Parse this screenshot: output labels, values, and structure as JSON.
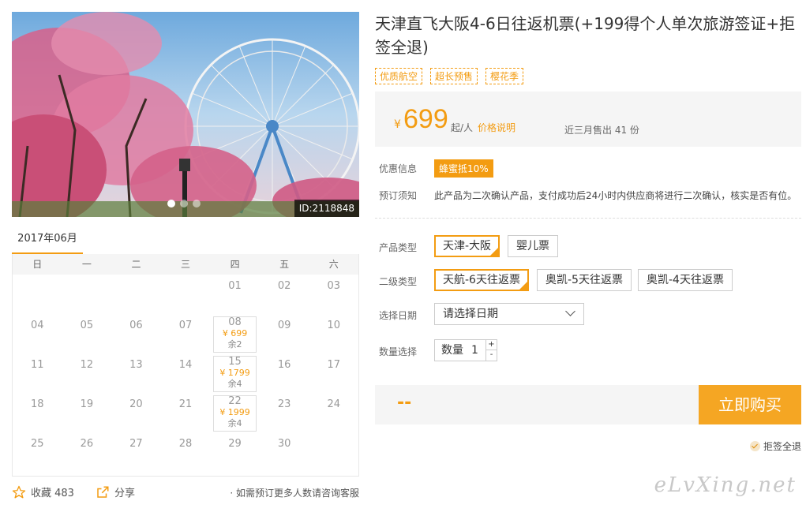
{
  "hero": {
    "id_label": "ID:2118848"
  },
  "calendar": {
    "month": "2017年06月",
    "weekdays": [
      "日",
      "一",
      "二",
      "三",
      "四",
      "五",
      "六"
    ],
    "days": [
      {
        "d": ""
      },
      {
        "d": ""
      },
      {
        "d": ""
      },
      {
        "d": ""
      },
      {
        "d": "01"
      },
      {
        "d": "02"
      },
      {
        "d": "03"
      },
      {
        "d": "04"
      },
      {
        "d": "05"
      },
      {
        "d": "06"
      },
      {
        "d": "07"
      },
      {
        "d": "08",
        "price": "¥ 699",
        "rem": "余2"
      },
      {
        "d": "09"
      },
      {
        "d": "10"
      },
      {
        "d": "11"
      },
      {
        "d": "12"
      },
      {
        "d": "13"
      },
      {
        "d": "14"
      },
      {
        "d": "15",
        "price": "¥ 1799",
        "rem": "余4"
      },
      {
        "d": "16"
      },
      {
        "d": "17"
      },
      {
        "d": "18"
      },
      {
        "d": "19"
      },
      {
        "d": "20"
      },
      {
        "d": "21"
      },
      {
        "d": "22",
        "price": "¥ 1999",
        "rem": "余4"
      },
      {
        "d": "23"
      },
      {
        "d": "24"
      },
      {
        "d": "25"
      },
      {
        "d": "26"
      },
      {
        "d": "27"
      },
      {
        "d": "28"
      },
      {
        "d": "29"
      },
      {
        "d": "30"
      },
      {
        "d": ""
      }
    ]
  },
  "footer": {
    "fav_label": "收藏 483",
    "share_label": "分享",
    "hint": "· 如需预订更多人数请咨询客服"
  },
  "product": {
    "title": "天津直飞大阪4-6日往返机票(+199得个人单次旅游签证+拒签全退)",
    "tags": [
      "优质航空",
      "超长预售",
      "樱花季"
    ],
    "price": {
      "yen": "¥",
      "amount": "699",
      "unit": "起/人",
      "explain": "价格说明",
      "sold": "近三月售出 41 份"
    },
    "promo_label": "优惠信息",
    "promo_badge": "蜂蜜抵10%",
    "notice_label": "预订须知",
    "notice_text": "此产品为二次确认产品，支付成功后24小时内供应商将进行二次确认，核实是否有位。",
    "type_label": "产品类型",
    "types": [
      "天津-大阪",
      "婴儿票"
    ],
    "subtype_label": "二级类型",
    "subtypes": [
      "天航-6天往返票",
      "奥凯-5天往返票",
      "奥凯-4天往返票"
    ],
    "date_label": "选择日期",
    "date_placeholder": "请选择日期",
    "qty_label": "数量选择",
    "qty_inner_label": "数量",
    "qty_value": "1",
    "qty_up": "+",
    "qty_down": "-",
    "total": "--",
    "buy_label": "立即购买",
    "refund_label": "拒签全退"
  },
  "watermark": "eLvXing.net",
  "colors": {
    "accent": "#f39c12",
    "button": "#f5a623"
  },
  "icons": [
    "star-icon",
    "share-icon",
    "chevron-down-icon",
    "check-circle-icon"
  ]
}
